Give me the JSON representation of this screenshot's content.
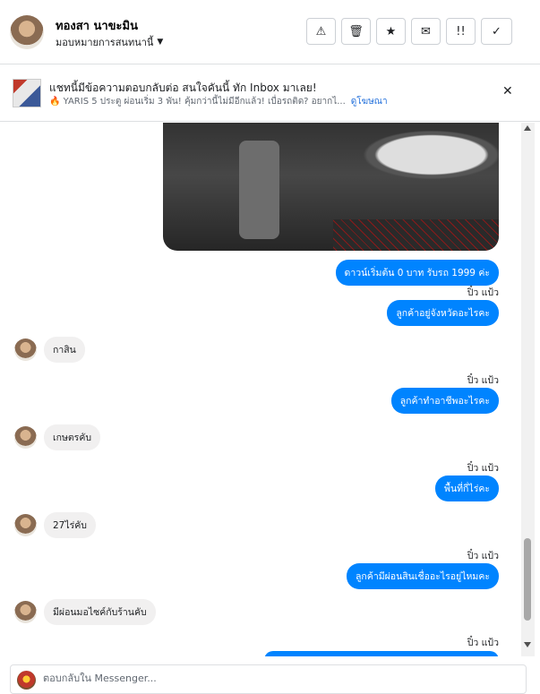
{
  "header": {
    "name": "ทองสา นาขะมิน",
    "assign_label": "มอบหมายการสนทนานี้",
    "toolbar_icons": [
      "warning-icon",
      "trash-icon",
      "star-icon",
      "mail-icon",
      "important-icon",
      "check-icon"
    ],
    "toolbar_glyphs": [
      "⚠",
      "🗑",
      "★",
      "✉",
      "!!",
      "✓"
    ]
  },
  "ad": {
    "title": "แชทนี้มีข้อความตอบกลับต่อ สนใจคันนี้ ทัก Inbox มาเลย!",
    "subtitle": "🔥 YARIS 5 ประตู ผ่อนเริ่ม 3 พัน! คุ้มกว่านี้ไม่มีอีกแล้ว! เบื่อรถติด? อยากไ...",
    "link": "ดูโฆษณา",
    "close": "✕"
  },
  "messages": [
    {
      "dir": "out",
      "text": "ดาวน์เริ่มต้น 0 บาท รับรถ 1999 ค่ะ"
    },
    {
      "dir": "out",
      "sender": "ปิ๋ว แป้ว",
      "text": "ลูกค้าอยู่จังหวัดอะไรคะ"
    },
    {
      "dir": "in",
      "text": "กาสิน"
    },
    {
      "dir": "out",
      "sender": "ปิ๋ว แป้ว",
      "text": "ลูกค้าทำอาชีพอะไรคะ"
    },
    {
      "dir": "in",
      "text": "เกษตรคับ"
    },
    {
      "dir": "out",
      "sender": "ปิ๋ว แป้ว",
      "text": "พื้นที่กี่ไร่คะ"
    },
    {
      "dir": "in",
      "text": "27ไร่คับ"
    },
    {
      "dir": "out",
      "sender": "ปิ๋ว แป้ว",
      "text": "ลูกค้ามีผ่อนสินเชื่ออะไรอยู่ไหมคะ"
    },
    {
      "dir": "in",
      "text": "มีผ่อนมอไซค์กับร้านคับ"
    },
    {
      "dir": "out",
      "sender": "ปิ๋ว แป้ว",
      "text": ""
    }
  ],
  "reply": {
    "placeholder": "ตอบกลับใน Messenger..."
  }
}
